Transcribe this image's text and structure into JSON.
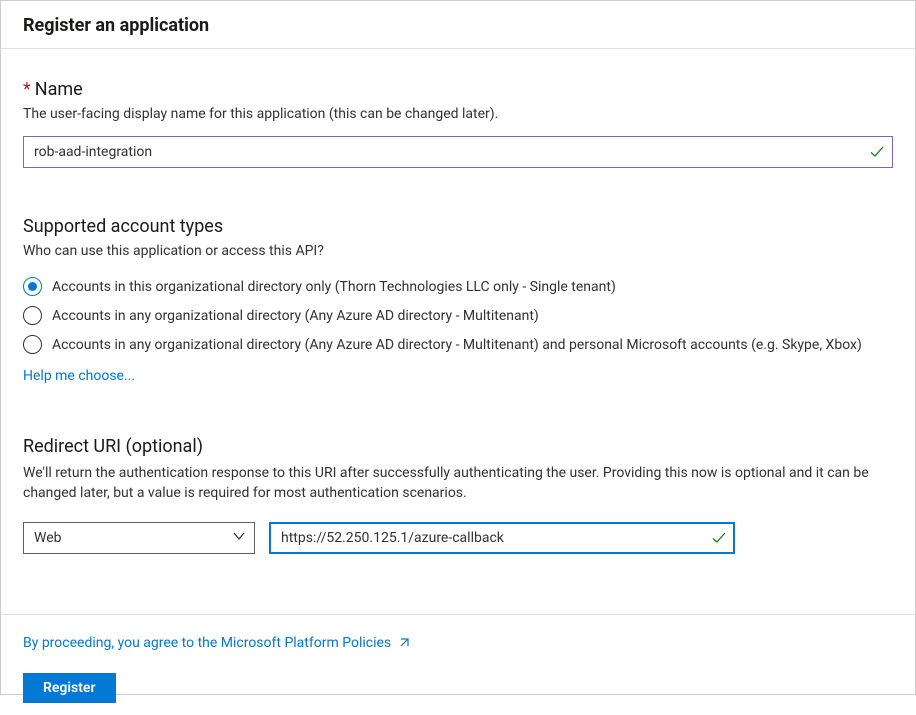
{
  "header": {
    "title": "Register an application"
  },
  "name": {
    "label": "Name",
    "desc": "The user-facing display name for this application (this can be changed later).",
    "value": "rob-aad-integration"
  },
  "accountTypes": {
    "title": "Supported account types",
    "desc": "Who can use this application or access this API?",
    "options": [
      {
        "label": "Accounts in this organizational directory only (Thorn Technologies LLC only - Single tenant)",
        "selected": true
      },
      {
        "label": "Accounts in any organizational directory (Any Azure AD directory - Multitenant)",
        "selected": false
      },
      {
        "label": "Accounts in any organizational directory (Any Azure AD directory - Multitenant) and personal Microsoft accounts (e.g. Skype, Xbox)",
        "selected": false
      }
    ],
    "helpLink": "Help me choose..."
  },
  "redirect": {
    "title": "Redirect URI (optional)",
    "desc": "We'll return the authentication response to this URI after successfully authenticating the user. Providing this now is optional and it can be changed later, but a value is required for most authentication scenarios.",
    "platform": "Web",
    "uri": "https://52.250.125.1/azure-callback"
  },
  "footer": {
    "policies": "By proceeding, you agree to the Microsoft Platform Policies",
    "registerLabel": "Register"
  }
}
